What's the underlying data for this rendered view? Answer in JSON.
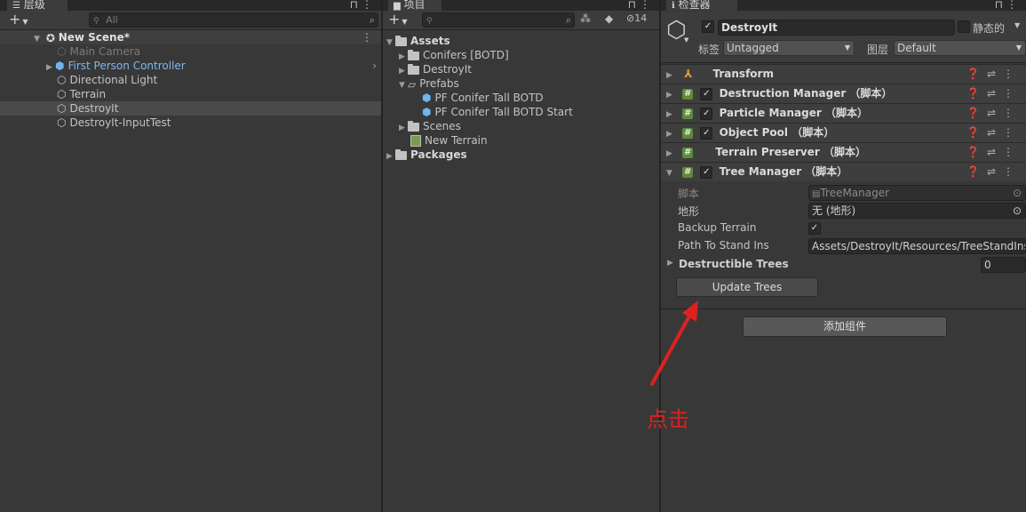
{
  "hierarchy": {
    "tab_label": "层级",
    "search_placeholder": "All",
    "scene_name": "New Scene*",
    "items": [
      {
        "label": "Main Camera"
      },
      {
        "label": "First Person Controller"
      },
      {
        "label": "Directional Light"
      },
      {
        "label": "Terrain"
      },
      {
        "label": "DestroyIt"
      },
      {
        "label": "DestroyIt-InputTest"
      }
    ]
  },
  "project": {
    "tab_label": "项目",
    "hidden_count": "14",
    "tree": [
      {
        "label": "Assets"
      },
      {
        "label": "Conifers [BOTD]"
      },
      {
        "label": "DestroyIt"
      },
      {
        "label": "Prefabs"
      },
      {
        "label": "PF Conifer Tall BOTD"
      },
      {
        "label": "PF Conifer Tall BOTD Start"
      },
      {
        "label": "Scenes"
      },
      {
        "label": "New Terrain"
      },
      {
        "label": "Packages"
      }
    ]
  },
  "inspector": {
    "tab_label": "检查器",
    "object_name": "DestroyIt",
    "static_label": "静态的",
    "tag_label": "标签",
    "tag_value": "Untagged",
    "layer_label": "图层",
    "layer_value": "Default",
    "components": [
      {
        "label": "Transform"
      },
      {
        "label": "Destruction Manager （脚本）"
      },
      {
        "label": "Particle Manager （脚本）"
      },
      {
        "label": "Object Pool （脚本）"
      },
      {
        "label": "Terrain Preserver （脚本）"
      },
      {
        "label": "Tree Manager （脚本）"
      }
    ],
    "fields": {
      "script_label": "脚本",
      "script_value": "TreeManager",
      "terrain_label": "地形",
      "terrain_value": "无 (地形)",
      "backup_label": "Backup Terrain",
      "path_label": "Path To Stand Ins",
      "path_value": "Assets/DestroyIt/Resources/TreeStandIns",
      "trees_label": "Destructible Trees",
      "trees_value": "0"
    },
    "update_button": "Update Trees",
    "add_component_button": "添加组件"
  },
  "annotation": {
    "text": "点击",
    "color": "#e02020"
  }
}
